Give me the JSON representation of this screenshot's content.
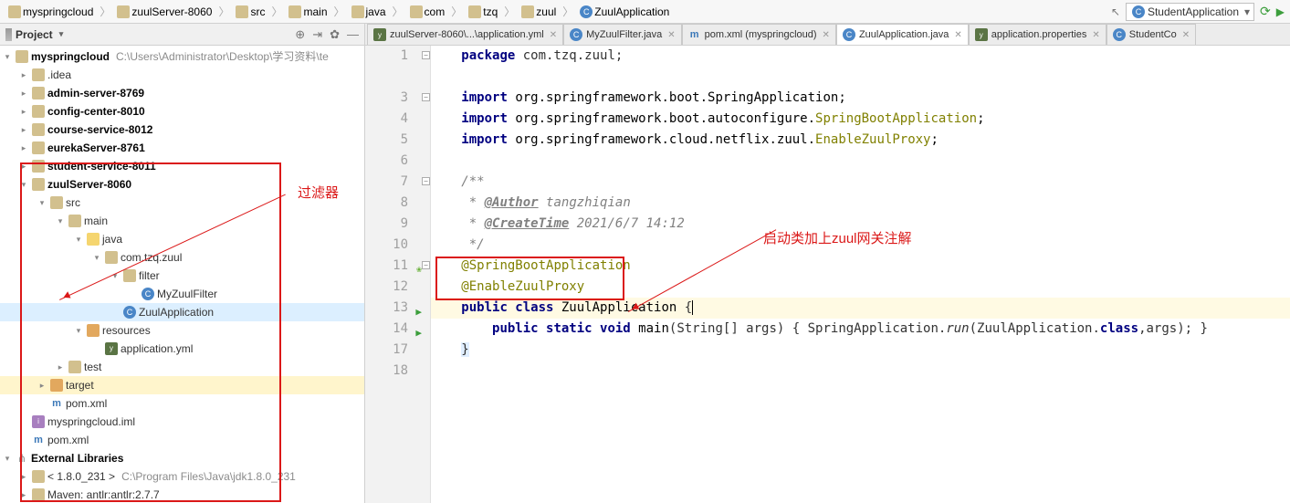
{
  "breadcrumbs": [
    "myspringcloud",
    "zuulServer-8060",
    "src",
    "main",
    "java",
    "com",
    "tzq",
    "zuul",
    "ZuulApplication"
  ],
  "runConfig": "StudentApplication",
  "sidebar": {
    "title": "Project",
    "rootName": "myspringcloud",
    "rootPath": "C:\\Users\\Administrator\\Desktop\\学习资料\\te",
    "items": [
      {
        "pad": 20,
        "arrow": "▸",
        "ico": "dir",
        "label": ".idea"
      },
      {
        "pad": 20,
        "arrow": "▸",
        "ico": "dir",
        "label": "admin-server-8769",
        "bold": true
      },
      {
        "pad": 20,
        "arrow": "▸",
        "ico": "dir",
        "label": "config-center-8010",
        "bold": true
      },
      {
        "pad": 20,
        "arrow": "▸",
        "ico": "dir",
        "label": "course-service-8012",
        "bold": true
      },
      {
        "pad": 20,
        "arrow": "▸",
        "ico": "dir",
        "label": "eurekaServer-8761",
        "bold": true
      },
      {
        "pad": 20,
        "arrow": "▸",
        "ico": "dir",
        "label": "student-service-8011",
        "bold": true
      },
      {
        "pad": 20,
        "arrow": "▾",
        "ico": "dir",
        "label": "zuulServer-8060",
        "bold": true
      },
      {
        "pad": 40,
        "arrow": "▾",
        "ico": "dir",
        "label": "src"
      },
      {
        "pad": 60,
        "arrow": "▾",
        "ico": "dir",
        "label": "main"
      },
      {
        "pad": 80,
        "arrow": "▾",
        "ico": "diry",
        "label": "java"
      },
      {
        "pad": 100,
        "arrow": "▾",
        "ico": "dir",
        "label": "com.tzq.zuul"
      },
      {
        "pad": 120,
        "arrow": "▾",
        "ico": "dir",
        "label": "filter"
      },
      {
        "pad": 140,
        "arrow": "",
        "ico": "cls",
        "label": "MyZuulFilter"
      },
      {
        "pad": 120,
        "arrow": "",
        "ico": "cls",
        "label": "ZuulApplication",
        "selected": true
      },
      {
        "pad": 80,
        "arrow": "▾",
        "ico": "diro",
        "label": "resources"
      },
      {
        "pad": 100,
        "arrow": "",
        "ico": "yml",
        "label": "application.yml"
      },
      {
        "pad": 60,
        "arrow": "▸",
        "ico": "dir",
        "label": "test"
      },
      {
        "pad": 40,
        "arrow": "▸",
        "ico": "diro",
        "label": "target",
        "hl": true
      },
      {
        "pad": 40,
        "arrow": "",
        "ico": "m",
        "label": "pom.xml"
      },
      {
        "pad": 20,
        "arrow": "",
        "ico": "iml",
        "label": "myspringcloud.iml"
      },
      {
        "pad": 20,
        "arrow": "",
        "ico": "m",
        "label": "pom.xml"
      }
    ],
    "extLib": "External Libraries",
    "jdk": "< 1.8.0_231 >",
    "jdkPath": "C:\\Program Files\\Java\\jdk1.8.0_231",
    "maven": "Maven: antlr:antlr:2.7.7"
  },
  "tabs": [
    {
      "ico": "yml",
      "label": "zuulServer-8060\\...\\application.yml"
    },
    {
      "ico": "cls",
      "label": "MyZuulFilter.java"
    },
    {
      "ico": "m",
      "label": "pom.xml (myspringcloud)"
    },
    {
      "ico": "cls",
      "label": "ZuulApplication.java",
      "active": true
    },
    {
      "ico": "yml",
      "label": "application.properties"
    },
    {
      "ico": "cls",
      "label": "StudentCo"
    }
  ],
  "code": {
    "lines": [
      "1",
      "",
      "3",
      "4",
      "5",
      "6",
      "7",
      "8",
      "9",
      "10",
      "11",
      "12",
      "13",
      "14",
      "17",
      "18"
    ],
    "package": "package ",
    "pkgname": "com.tzq.zuul;",
    "import": "import ",
    "imports": [
      {
        "pre": "org.springframework.boot.SpringApplication;"
      },
      {
        "pre": "org.springframework.boot.autoconfigure.",
        "hl": "SpringBootApplication",
        "post": ";"
      },
      {
        "pre": "org.springframework.cloud.netflix.zuul.",
        "hl": "EnableZuulProxy",
        "post": ";"
      }
    ],
    "doc_open": "/**",
    "doc_author": " * @Author tangzhiqian",
    "doc_author_tag": "@Author",
    "doc_author_val": "tangzhiqian",
    "doc_time_tag": "@CreateTime",
    "doc_time_val": "2021/6/7 14:12",
    "doc_close": " */",
    "anno1": "@SpringBootApplication",
    "anno2": "@EnableZuulProxy",
    "classline_kw1": "public class ",
    "classname": "ZuulApplication ",
    "mainline_kw": "public static void ",
    "mainline_fn": "main",
    "mainline_args": "(String[] args) { SpringApplication.",
    "mainline_run": "run",
    "mainline_tail": "(ZuulApplication.",
    "mainline_class": "class",
    "mainline_end": ",args); }"
  },
  "annotations": {
    "filter": "过滤器",
    "zuul": "启动类加上zuul网关注解"
  }
}
